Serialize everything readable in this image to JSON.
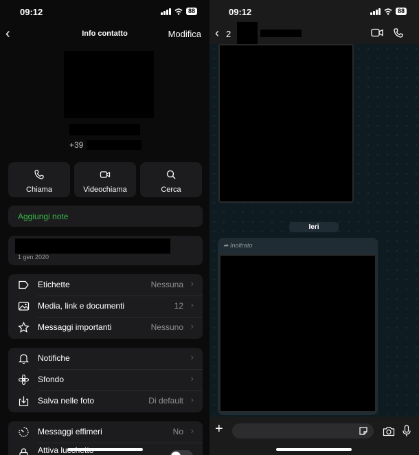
{
  "status_bar": {
    "left_time": "09:12",
    "right_time": "09:12",
    "battery": "88"
  },
  "contact_info": {
    "title": "Info contatto",
    "edit_label": "Modifica",
    "phone_prefix": "+39",
    "actions": [
      {
        "label": "Chiama",
        "icon": "phone-icon"
      },
      {
        "label": "Videochiama",
        "icon": "video-icon"
      },
      {
        "label": "Cerca",
        "icon": "search-icon"
      }
    ],
    "add_notes_label": "Aggiungi note",
    "about_date": "1 gen 2020",
    "group1": [
      {
        "label": "Etichette",
        "value": "Nessuna",
        "icon": "label-icon"
      },
      {
        "label": "Media, link e documenti",
        "value": "12",
        "icon": "media-icon"
      },
      {
        "label": "Messaggi importanti",
        "value": "Nessuno",
        "icon": "star-icon"
      }
    ],
    "group2": [
      {
        "label": "Notifiche",
        "value": "",
        "icon": "bell-icon"
      },
      {
        "label": "Sfondo",
        "value": "",
        "icon": "wallpaper-icon"
      },
      {
        "label": "Salva nelle foto",
        "value": "Di default",
        "icon": "save-photos-icon"
      }
    ],
    "group3": [
      {
        "label": "Messaggi effimeri",
        "value": "No",
        "icon": "timer-icon"
      },
      {
        "label": "Attiva lucchetto",
        "value": "",
        "icon": "lock-icon"
      }
    ],
    "accent_color": "#39b54a"
  },
  "chat": {
    "back_count": "2",
    "date_chip": "Ieri",
    "forwarded_label": "Inoltrato"
  }
}
